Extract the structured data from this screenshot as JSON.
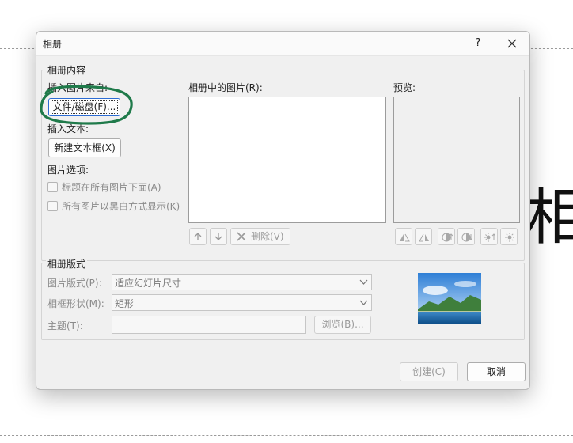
{
  "background": {
    "partial_text": "相框",
    "dash_color": "#9a9a9a"
  },
  "dialog": {
    "title": "相册",
    "help_label": "?",
    "album_content": {
      "legend": "相册内容",
      "insert_picture_from_label": "插入图片来自:",
      "file_disk_button": "文件/磁盘(F)...",
      "insert_text_label": "插入文本:",
      "new_textbox_button": "新建文本框(X)",
      "picture_options_label": "图片选项:",
      "captions_below_all": "标题在所有图片下面(A)",
      "all_black_and_white": "所有图片以黑白方式显示(K)",
      "pictures_in_album_label": "相册中的图片(R):",
      "preview_label": "预览:",
      "remove_button": "删除(V)"
    },
    "album_layout": {
      "legend": "相册版式",
      "picture_layout_label": "图片版式(P):",
      "picture_layout_value": "适应幻灯片尺寸",
      "frame_shape_label": "相框形状(M):",
      "frame_shape_value": "矩形",
      "theme_label": "主题(T):",
      "theme_value": "",
      "browse_button": "浏览(B)..."
    },
    "create_button": "创建(C)",
    "cancel_button": "取消"
  },
  "colors": {
    "focus_border": "#2c6cd4",
    "annotation_stroke": "#1f7a4a",
    "dialog_bg": "#f0f0f0"
  },
  "icons": [
    "close-icon",
    "move-up-icon",
    "move-down-icon",
    "remove-x-icon",
    "rotate-left-icon",
    "rotate-right-icon",
    "contrast-up-icon",
    "contrast-down-icon",
    "brightness-up-icon",
    "brightness-down-icon",
    "chevron-down-icon"
  ]
}
